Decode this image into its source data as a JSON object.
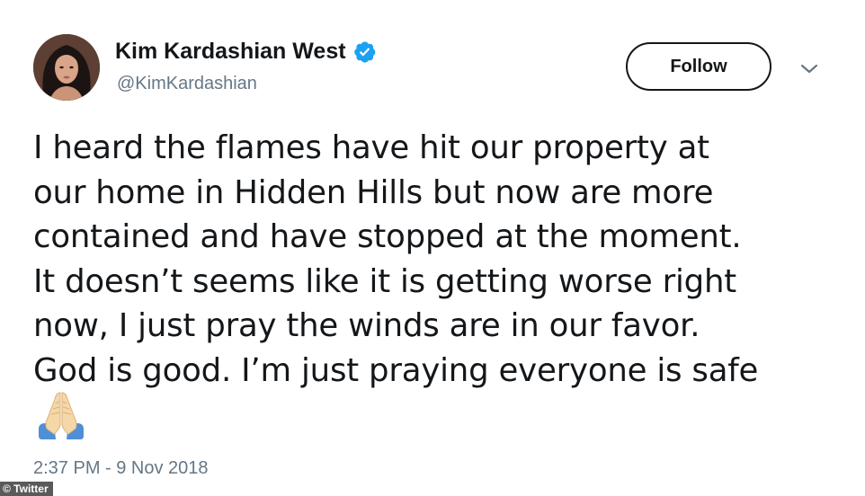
{
  "user": {
    "display_name": "Kim Kardashian West",
    "handle": "@KimKardashian",
    "verified_icon": "verified-badge-icon"
  },
  "actions": {
    "follow_label": "Follow",
    "more_icon": "chevron-down-icon"
  },
  "tweet": {
    "lines": [
      "I heard the flames have hit our property at",
      "our home in Hidden Hills but now are more",
      "contained and have stopped at the moment.",
      "It doesn’t seems like it is getting worse right",
      "now, I just pray the winds are in our favor.",
      "God is good. I’m just praying everyone is safe"
    ],
    "emoji": "folded-hands-emoji",
    "timestamp": "2:37 PM - 9 Nov 2018"
  },
  "credit": "© Twitter",
  "colors": {
    "text_primary": "#14171a",
    "text_secondary": "#657786",
    "verified_blue": "#1da1f2"
  }
}
